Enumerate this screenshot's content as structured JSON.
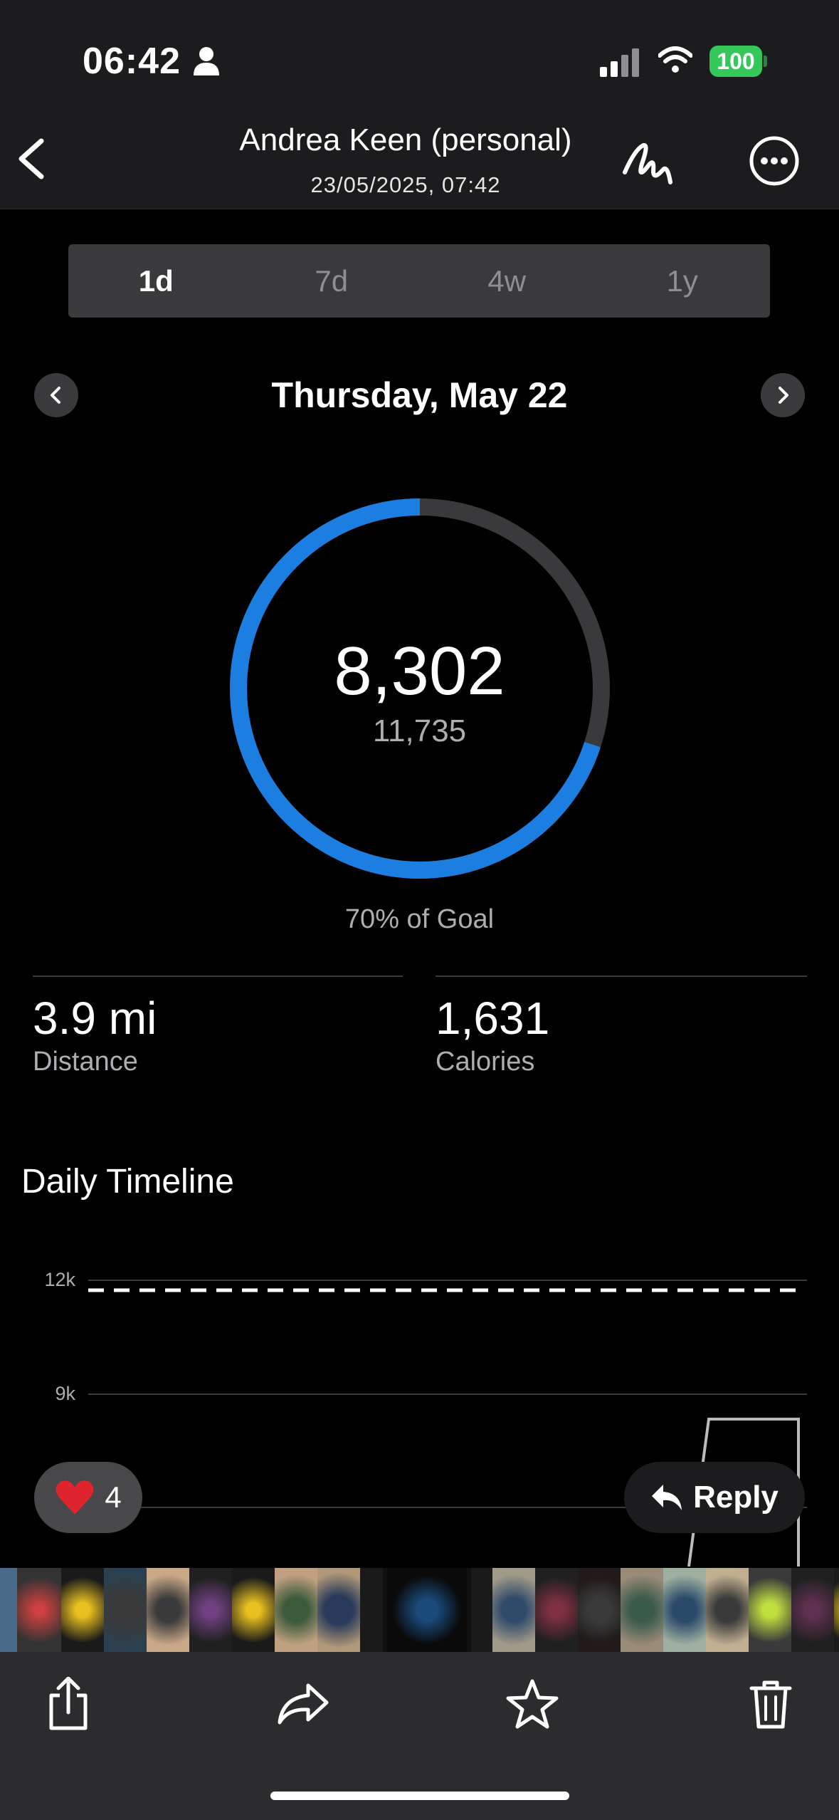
{
  "status_bar": {
    "time": "06:42",
    "battery": "100"
  },
  "header": {
    "sender": "Andrea Keen (personal)",
    "date": "23/05/2025, 07:42"
  },
  "range_tabs": [
    {
      "label": "1d",
      "active": true
    },
    {
      "label": "7d",
      "active": false
    },
    {
      "label": "4w",
      "active": false
    },
    {
      "label": "1y",
      "active": false
    }
  ],
  "day": {
    "title": "Thursday, May 22"
  },
  "steps": {
    "value": "8,302",
    "goal": "11,735",
    "goal_fraction": 0.7,
    "goal_text": "70% of Goal"
  },
  "stats": [
    {
      "value": "3.9 mi",
      "label": "Distance"
    },
    {
      "value": "1,631",
      "label": "Calories"
    }
  ],
  "timeline": {
    "title": "Daily Timeline",
    "chart_data": {
      "type": "line",
      "y_ticks": [
        "12k",
        "9k"
      ],
      "goal_line": 11735
    }
  },
  "reaction": {
    "emoji": "❤️",
    "count": "4"
  },
  "reply": {
    "label": "Reply"
  },
  "colors": {
    "accent": "#1c7ee0",
    "ring_track": "#3a3a3c",
    "battery": "#34c759"
  },
  "icons": [
    "back-chevron-icon",
    "markup-icon",
    "more-icon",
    "share-icon",
    "forward-icon",
    "star-icon",
    "trash-icon"
  ]
}
